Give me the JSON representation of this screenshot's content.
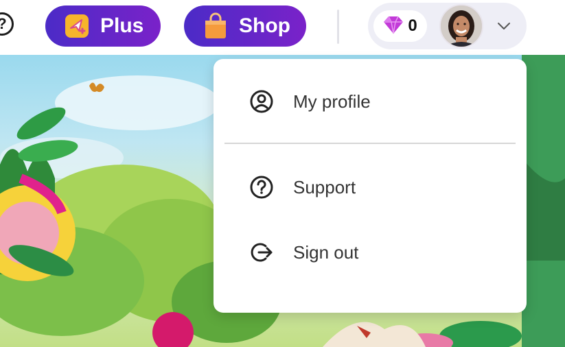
{
  "header": {
    "help_glyph": "?",
    "plus_label": "Plus",
    "shop_label": "Shop",
    "gem_count": "0"
  },
  "menu": {
    "items": [
      {
        "label": "My profile",
        "icon": "user-circle-icon"
      },
      {
        "label": "Support",
        "icon": "question-circle-icon"
      },
      {
        "label": "Sign out",
        "icon": "sign-out-icon"
      }
    ]
  },
  "colors": {
    "pill_gradient_start": "#4b2bc7",
    "pill_gradient_end": "#7a22c9",
    "account_bg": "#eeeef6",
    "gem": "#c23ad8"
  }
}
